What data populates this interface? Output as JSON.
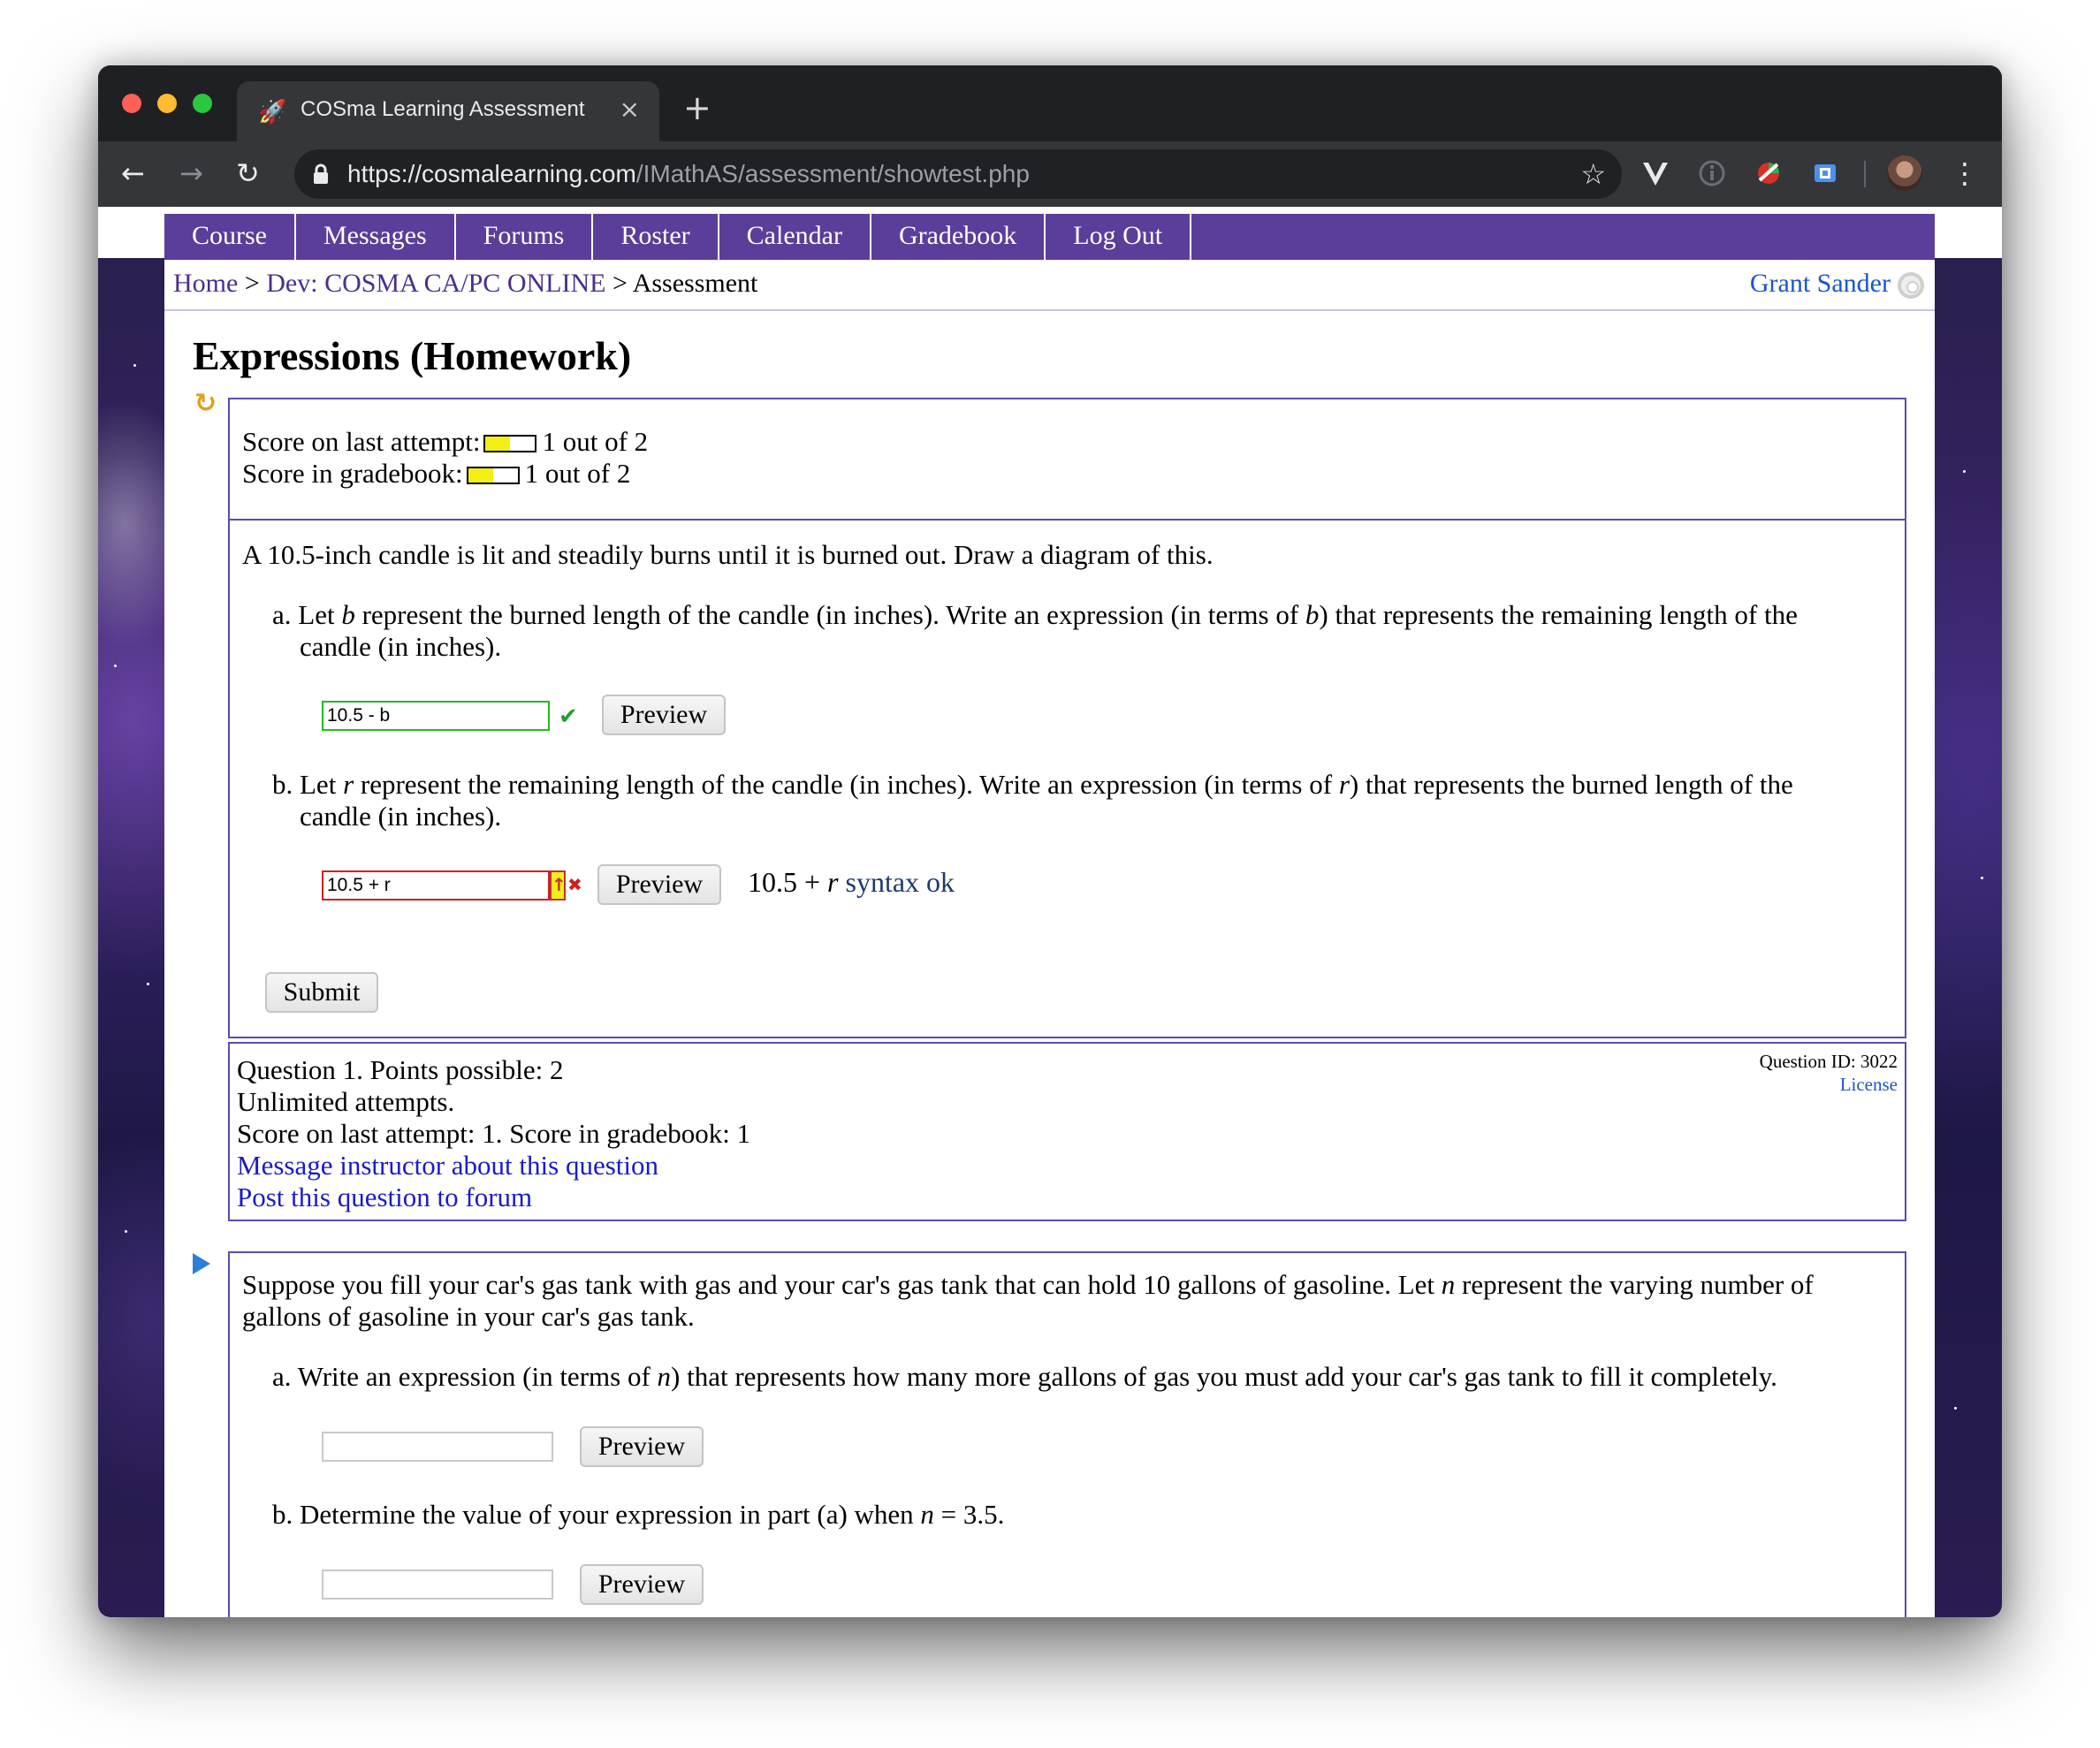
{
  "browser": {
    "tab_title": "COSma Learning Assessment",
    "tab_close": "×",
    "new_tab": "+",
    "url_domain": "https://cosmalearning.com",
    "url_path": "/IMathAS/assessment/showtest.php",
    "back": "←",
    "forward": "→",
    "reload": "↻",
    "star": "☆",
    "menu": "⋮"
  },
  "nav": {
    "items": [
      "Course",
      "Messages",
      "Forums",
      "Roster",
      "Calendar",
      "Gradebook",
      "Log Out"
    ]
  },
  "breadcrumb": {
    "home": "Home",
    "sep1": " > ",
    "course": "Dev: COSMA CA/PC ONLINE",
    "sep2": " > ",
    "current": "Assessment"
  },
  "user_name": "Grant Sander",
  "page_title": "Expressions (Homework)",
  "question1": {
    "score_last_label": "Score on last attempt:",
    "score_last_value": "1 out of 2",
    "score_last_fraction": 0.5,
    "score_gradebook_label": "Score in gradebook:",
    "score_gradebook_value": "1 out of 2",
    "score_gradebook_fraction": 0.5,
    "prompt": "A 10.5-inch candle is lit and steadily burns until it is burned out. Draw a diagram of this.",
    "part_a": {
      "label": "a.",
      "text_1": "Let ",
      "var": "b",
      "text_2": " represent the burned length of the candle (in inches). Write an expression (in terms of ",
      "text_3": ") that represents the remaining length of the",
      "text_4": "candle (in inches).",
      "answer": "10.5 - b",
      "status_icon": "✔",
      "preview_label": "Preview"
    },
    "part_b": {
      "label": "b.",
      "text_1": "Let ",
      "var": "r",
      "text_2": " represent the remaining length of the candle (in inches). Write an expression (in terms of ",
      "text_3": ") that represents the burned length of the",
      "text_4": "candle (in inches).",
      "answer": "10.5 + r",
      "warn_icon": "↑",
      "x_icon": "✖",
      "preview_label": "Preview",
      "preview_math_num": "10.5 + ",
      "preview_math_var": "r",
      "preview_status": " syntax ok"
    },
    "submit_label": "Submit"
  },
  "question_info": {
    "line1": "Question 1. Points possible: 2",
    "line2": "Unlimited attempts.",
    "line3": "Score on last attempt: 1. Score in gradebook: 1",
    "link1": "Message instructor about this question",
    "link2": "Post this question to forum",
    "qid": "Question ID: 3022",
    "license": "License"
  },
  "question2": {
    "prompt_1": "Suppose you fill your car's gas tank with gas and your car's gas tank that can hold 10 gallons of gasoline. Let ",
    "var": "n",
    "prompt_2": " represent the varying number of",
    "prompt_3": "gallons of gasoline in your car's gas tank.",
    "part_a": {
      "label": "a.",
      "text_1": "Write an expression (in terms of ",
      "text_2": ") that represents how many more gallons of gas you must add your car's gas tank to fill it completely.",
      "answer": "",
      "preview_label": "Preview"
    },
    "part_b": {
      "label": "b.",
      "text_1": "Determine the value of your expression in part (a) when ",
      "text_2": " = 3.5.",
      "answer": "",
      "preview_label": "Preview"
    }
  }
}
